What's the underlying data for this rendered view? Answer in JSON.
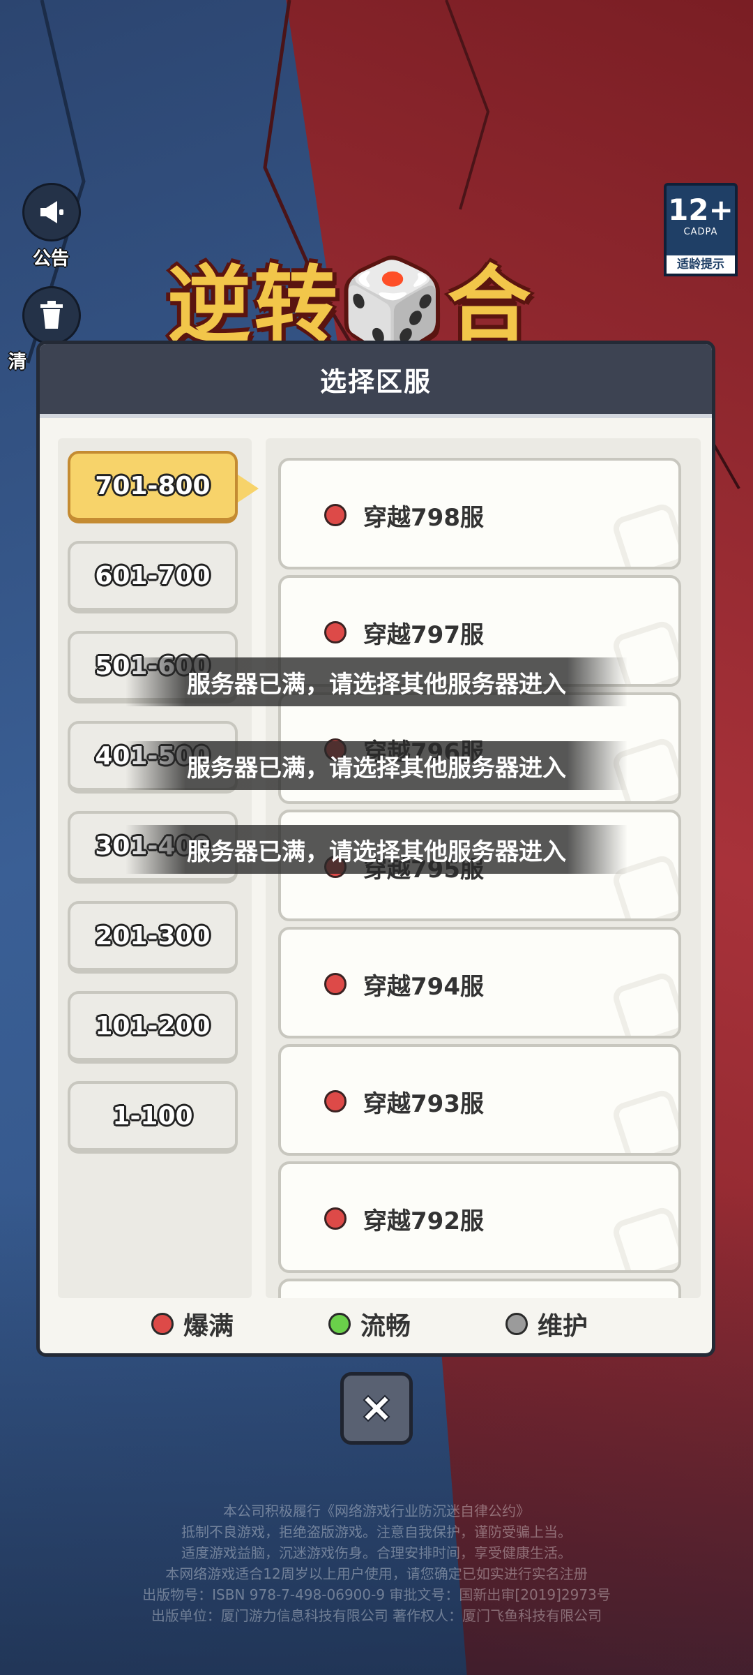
{
  "sidebar": {
    "notice_label": "公告",
    "clear_label": "清"
  },
  "age_badge": {
    "rating": "12+",
    "org": "CADPA",
    "tip": "适龄提示"
  },
  "logo_text": "逆转🎲合",
  "dialog": {
    "title": "选择区服",
    "ranges": [
      {
        "label": "701-800",
        "active": true
      },
      {
        "label": "601-700"
      },
      {
        "label": "501-600"
      },
      {
        "label": "401-500"
      },
      {
        "label": "301-400"
      },
      {
        "label": "201-300"
      },
      {
        "label": "101-200"
      },
      {
        "label": "1-100"
      }
    ],
    "servers": [
      {
        "name": "穿越798服",
        "status": "full"
      },
      {
        "name": "穿越797服",
        "status": "full"
      },
      {
        "name": "穿越796服",
        "status": "full"
      },
      {
        "name": "穿越795服",
        "status": "full"
      },
      {
        "name": "穿越794服",
        "status": "full"
      },
      {
        "name": "穿越793服",
        "status": "full"
      },
      {
        "name": "穿越792服",
        "status": "full"
      }
    ],
    "legend": [
      {
        "label": "爆满",
        "color": "#dd4a48"
      },
      {
        "label": "流畅",
        "color": "#6ad04a"
      },
      {
        "label": "维护",
        "color": "#9b9b9b"
      }
    ]
  },
  "toasts": [
    "服务器已满，请选择其他服务器进入",
    "服务器已满，请选择其他服务器进入",
    "服务器已满，请选择其他服务器进入"
  ],
  "legal_lines": [
    "本公司积极履行《网络游戏行业防沉迷自律公约》",
    "抵制不良游戏，拒绝盗版游戏。注意自我保护，谨防受骗上当。",
    "适度游戏益脑，沉迷游戏伤身。合理安排时间，享受健康生活。",
    "本网络游戏适合12周岁以上用户使用，请您确定已如实进行实名注册",
    "出版物号：ISBN 978-7-498-06900-9  审批文号：国新出审[2019]2973号",
    "出版单位：厦门游力信息科技有限公司  著作权人：厦门飞鱼科技有限公司"
  ]
}
